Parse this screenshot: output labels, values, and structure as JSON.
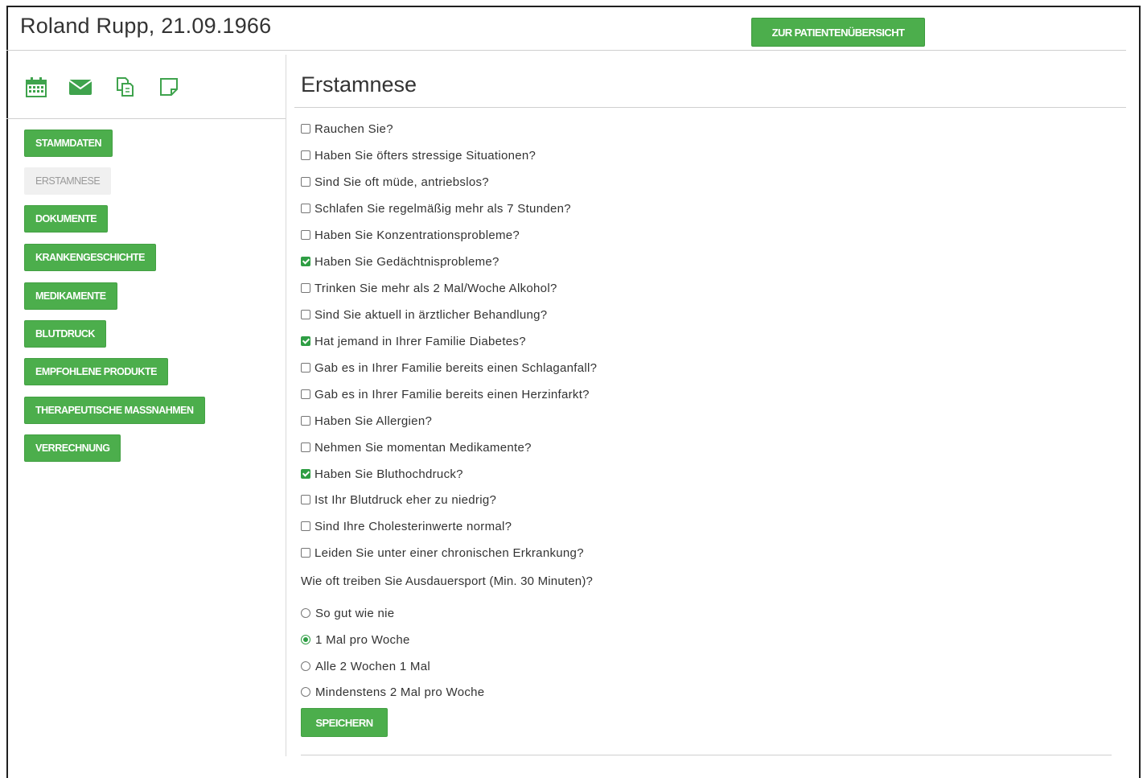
{
  "header": {
    "patient_name": "Roland Rupp, 21.09.1966",
    "overview_button": "ZUR PATIENTENÜBERSICHT"
  },
  "sidebar": {
    "icons": [
      "calendar-icon",
      "envelope-icon",
      "copy-icon",
      "note-icon"
    ],
    "items": [
      {
        "label": "STAMMDATEN",
        "active": false
      },
      {
        "label": "ERSTAMNESE",
        "active": true
      },
      {
        "label": "DOKUMENTE",
        "active": false
      },
      {
        "label": "KRANKENGESCHICHTE",
        "active": false
      },
      {
        "label": "MEDIKAMENTE",
        "active": false
      },
      {
        "label": "BLUTDRUCK",
        "active": false
      },
      {
        "label": "EMPFOHLENE PRODUKTE",
        "active": false
      },
      {
        "label": "THERAPEUTISCHE MASSNAHMEN",
        "active": false
      },
      {
        "label": "VERRECHNUNG",
        "active": false
      }
    ]
  },
  "main": {
    "title": "Erstamnese",
    "questions": [
      {
        "label": "Rauchen Sie?",
        "checked": false
      },
      {
        "label": "Haben Sie öfters stressige Situationen?",
        "checked": false
      },
      {
        "label": "Sind Sie oft müde, antriebslos?",
        "checked": false
      },
      {
        "label": "Schlafen Sie regelmäßig mehr als 7 Stunden?",
        "checked": false
      },
      {
        "label": "Haben Sie Konzentrationsprobleme?",
        "checked": false
      },
      {
        "label": "Haben Sie Gedächtnisprobleme?",
        "checked": true
      },
      {
        "label": "Trinken Sie mehr als 2 Mal/Woche Alkohol?",
        "checked": false
      },
      {
        "label": "Sind Sie aktuell in ärztlicher Behandlung?",
        "checked": false
      },
      {
        "label": "Hat jemand in Ihrer Familie Diabetes?",
        "checked": true
      },
      {
        "label": "Gab es in Ihrer Familie bereits einen Schlaganfall?",
        "checked": false
      },
      {
        "label": "Gab es in Ihrer Familie bereits einen Herzinfarkt?",
        "checked": false
      },
      {
        "label": "Haben Sie Allergien?",
        "checked": false
      },
      {
        "label": "Nehmen Sie momentan Medikamente?",
        "checked": false
      },
      {
        "label": "Haben Sie Bluthochdruck?",
        "checked": true
      },
      {
        "label": "Ist Ihr Blutdruck eher zu niedrig?",
        "checked": false
      },
      {
        "label": "Sind Ihre Cholesterinwerte normal?",
        "checked": false
      },
      {
        "label": "Leiden Sie unter einer chronischen Erkrankung?",
        "checked": false
      }
    ],
    "frequency": {
      "label": "Wie oft treiben Sie Ausdauersport (Min. 30 Minuten)?",
      "options": [
        {
          "label": "So gut wie nie",
          "selected": false
        },
        {
          "label": "1 Mal pro Woche",
          "selected": true
        },
        {
          "label": "Alle 2 Wochen 1 Mal",
          "selected": false
        },
        {
          "label": "Mindenstens 2 Mal pro Woche",
          "selected": false
        }
      ]
    },
    "save_button": "SPEICHERN"
  },
  "colors": {
    "accent": "#4cae4c",
    "check": "#2f9e44",
    "text": "#333333",
    "disabled_bg": "#f0f0f0",
    "disabled_text": "#9a9a9a"
  }
}
